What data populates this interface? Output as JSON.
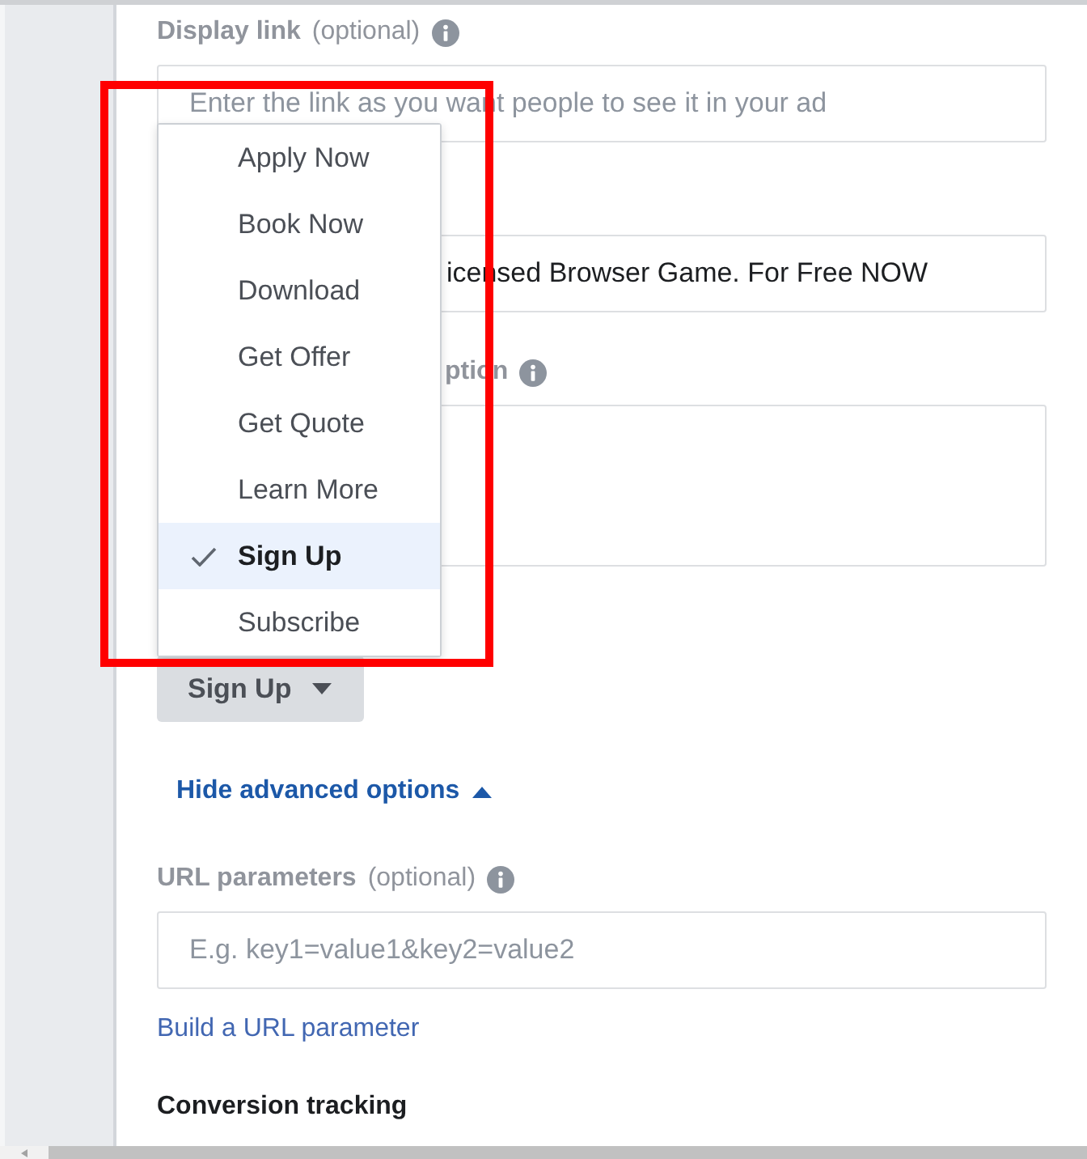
{
  "fields": [
    {
      "kind": "input",
      "label": "Display link",
      "hint": "(optional)",
      "info": true,
      "placeholder": "Enter the link as you want people to see it in your ad"
    },
    {
      "kind": "input",
      "value": "icensed Browser Game. For Free NOW"
    },
    {
      "kind": "textarea",
      "label": "ption",
      "info": true
    },
    {
      "kind": "select",
      "value": "Sign Up",
      "expanded": true,
      "options": [
        {
          "label": "Apply Now",
          "selected": false
        },
        {
          "label": "Book Now",
          "selected": false
        },
        {
          "label": "Download",
          "selected": false
        },
        {
          "label": "Get Offer",
          "selected": false
        },
        {
          "label": "Get Quote",
          "selected": false
        },
        {
          "label": "Learn More",
          "selected": false
        },
        {
          "label": "Sign Up",
          "selected": true
        },
        {
          "label": "Subscribe",
          "selected": false
        }
      ]
    }
  ],
  "advanced_toggle": {
    "label": "Hide advanced options",
    "expanded": true
  },
  "url_parameters": {
    "label": "URL parameters",
    "hint": "(optional)",
    "info": true,
    "placeholder": "E.g. key1=value1&key2=value2",
    "link": "Build a URL parameter"
  },
  "conversion_tracking": {
    "heading": "Conversion tracking"
  }
}
